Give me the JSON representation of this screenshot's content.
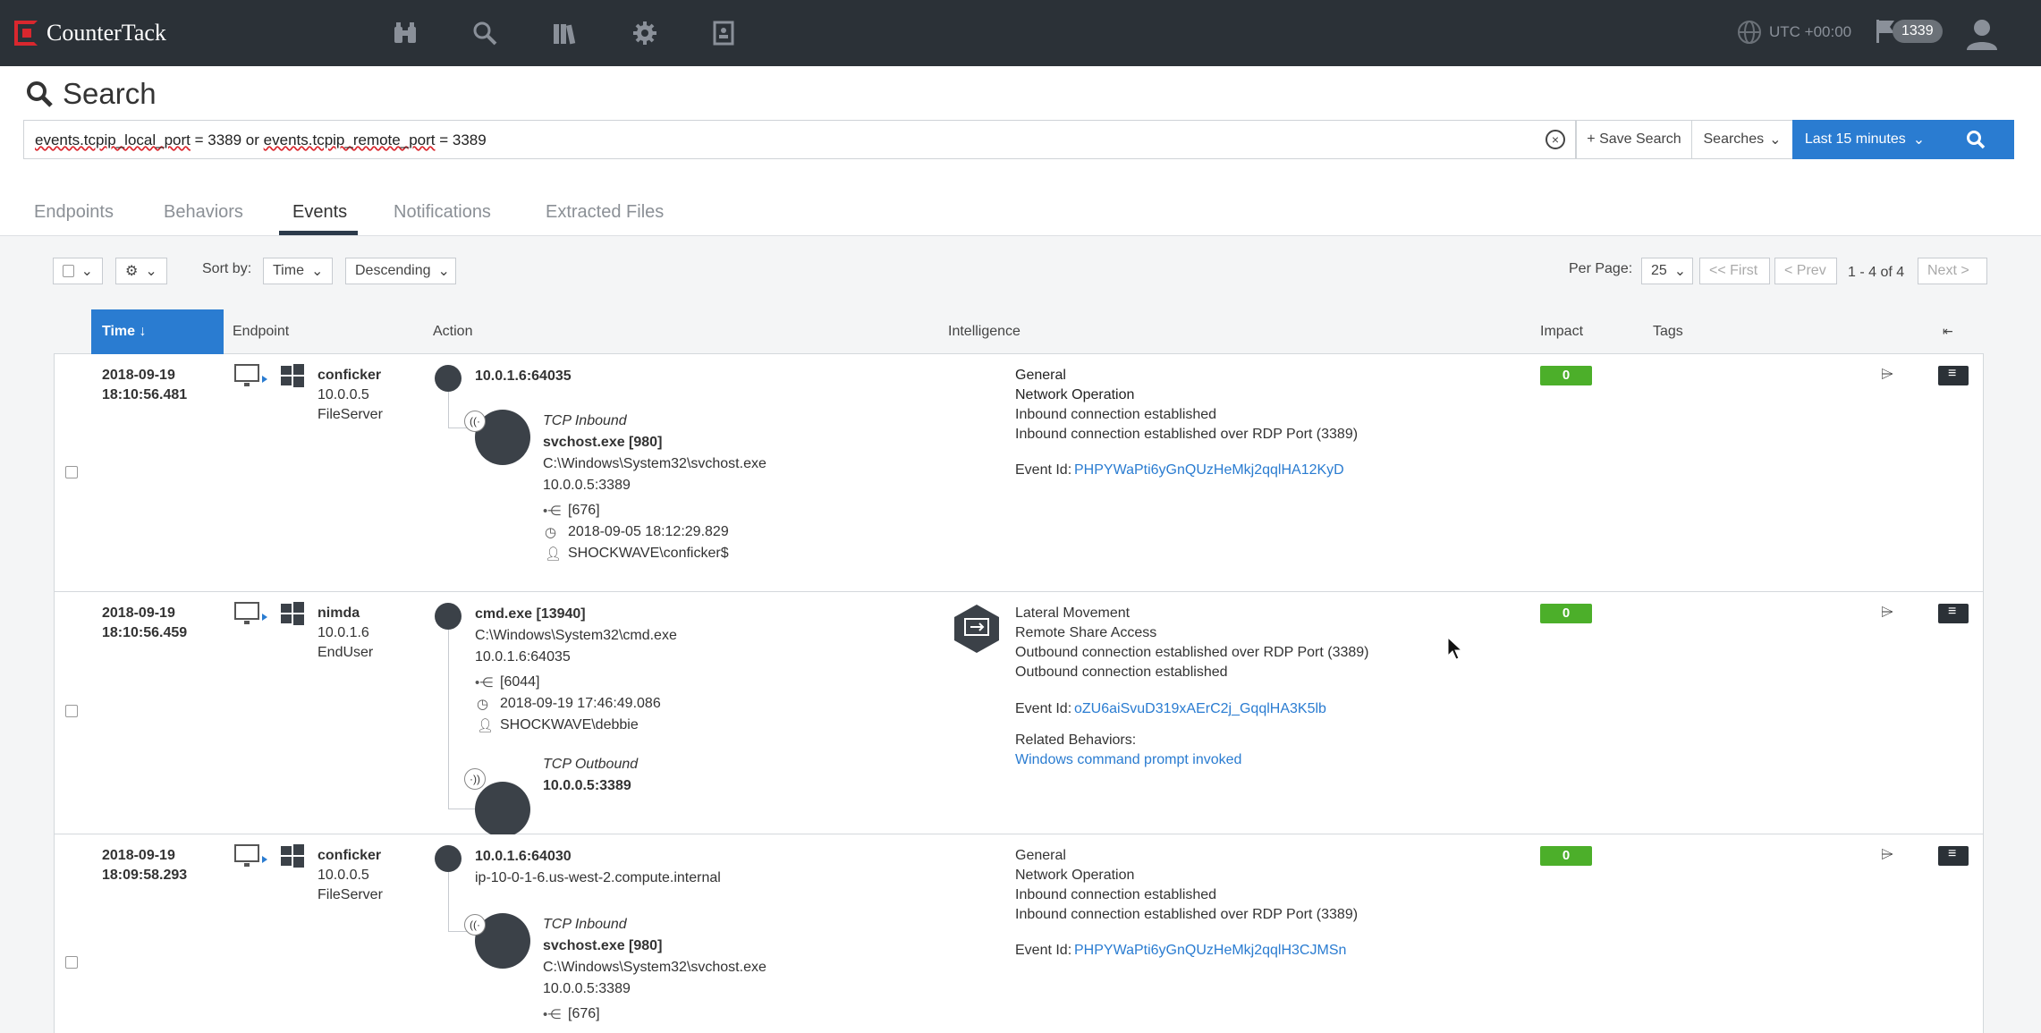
{
  "app": {
    "brand": "CounterTack",
    "utc": "UTC +00:00",
    "flag_count": "1339"
  },
  "nav_icons": [
    "binoculars-icon",
    "search-icon",
    "library-icon",
    "gear-icon",
    "report-icon"
  ],
  "search": {
    "title": "Search",
    "query_part1": "events.tcpip_local_port",
    "query_part2": " = 3389 or ",
    "query_part3": "events.tcpip_remote_port",
    "query_part4": " = 3389",
    "save_label": "+ Save Search",
    "searches_label": "Searches",
    "time_range": "Last 15 minutes"
  },
  "tabs": [
    "Endpoints",
    "Behaviors",
    "Events",
    "Notifications",
    "Extracted Files"
  ],
  "toolbar": {
    "sort_by_label": "Sort by:",
    "sort_field": "Time",
    "sort_order": "Descending",
    "per_page_label": "Per Page:",
    "per_page": "25",
    "first": "<< First",
    "prev": "< Prev",
    "range": "1 - 4 of 4",
    "next": "Next >"
  },
  "columns": {
    "time": "Time ↓",
    "endpoint": "Endpoint",
    "action": "Action",
    "intelligence": "Intelligence",
    "impact": "Impact",
    "tags": "Tags"
  },
  "rows": [
    {
      "date": "2018-09-19",
      "time": "18:10:56.481",
      "host": "conficker",
      "ip": "10.0.0.5",
      "role": "FileServer",
      "action_top": "10.0.1.6:64035",
      "conn_type": "TCP Inbound",
      "proc": "svchost.exe [980]",
      "path": "C:\\Windows\\System32\\svchost.exe",
      "addr": "10.0.0.5:3389",
      "pid": "[676]",
      "ts": "2018-09-05 18:12:29.829",
      "user": "SHOCKWAVE\\conficker$",
      "intel_1": "General",
      "intel_2": "Network Operation",
      "intel_3": "Inbound connection established",
      "intel_4": "Inbound connection established over RDP Port (3389)",
      "event_id_label": "Event Id:",
      "event_id": "PHPYWaPti6yGnQUzHeMkj2qqlHA12KyD",
      "impact": "0"
    },
    {
      "date": "2018-09-19",
      "time": "18:10:56.459",
      "host": "nimda",
      "ip": "10.0.1.6",
      "role": "EndUser",
      "proc": "cmd.exe [13940]",
      "path": "C:\\Windows\\System32\\cmd.exe",
      "addr": "10.0.1.6:64035",
      "pid": "[6044]",
      "ts": "2018-09-19 17:46:49.086",
      "user": "SHOCKWAVE\\debbie",
      "conn_type": "TCP Outbound",
      "remote": "10.0.0.5:3389",
      "intel_1": "Lateral Movement",
      "intel_2": "Remote Share Access",
      "intel_3": "Outbound connection established over RDP Port (3389)",
      "intel_4": "Outbound connection established",
      "event_id_label": "Event Id:",
      "event_id": "oZU6aiSvuD319xAErC2j_GqqlHA3K5lb",
      "related_label": "Related Behaviors:",
      "related": "Windows command prompt invoked",
      "impact": "0"
    },
    {
      "date": "2018-09-19",
      "time": "18:09:58.293",
      "host": "conficker",
      "ip": "10.0.0.5",
      "role": "FileServer",
      "action_top": "10.0.1.6:64030",
      "action_sub": "ip-10-0-1-6.us-west-2.compute.internal",
      "conn_type": "TCP Inbound",
      "proc": "svchost.exe [980]",
      "path": "C:\\Windows\\System32\\svchost.exe",
      "addr": "10.0.0.5:3389",
      "pid": "[676]",
      "intel_1": "General",
      "intel_2": "Network Operation",
      "intel_3": "Inbound connection established",
      "intel_4": "Inbound connection established over RDP Port (3389)",
      "event_id_label": "Event Id:",
      "event_id": "PHPYWaPti6yGnQUzHeMkj2qqlH3CJMSn",
      "impact": "0"
    }
  ]
}
